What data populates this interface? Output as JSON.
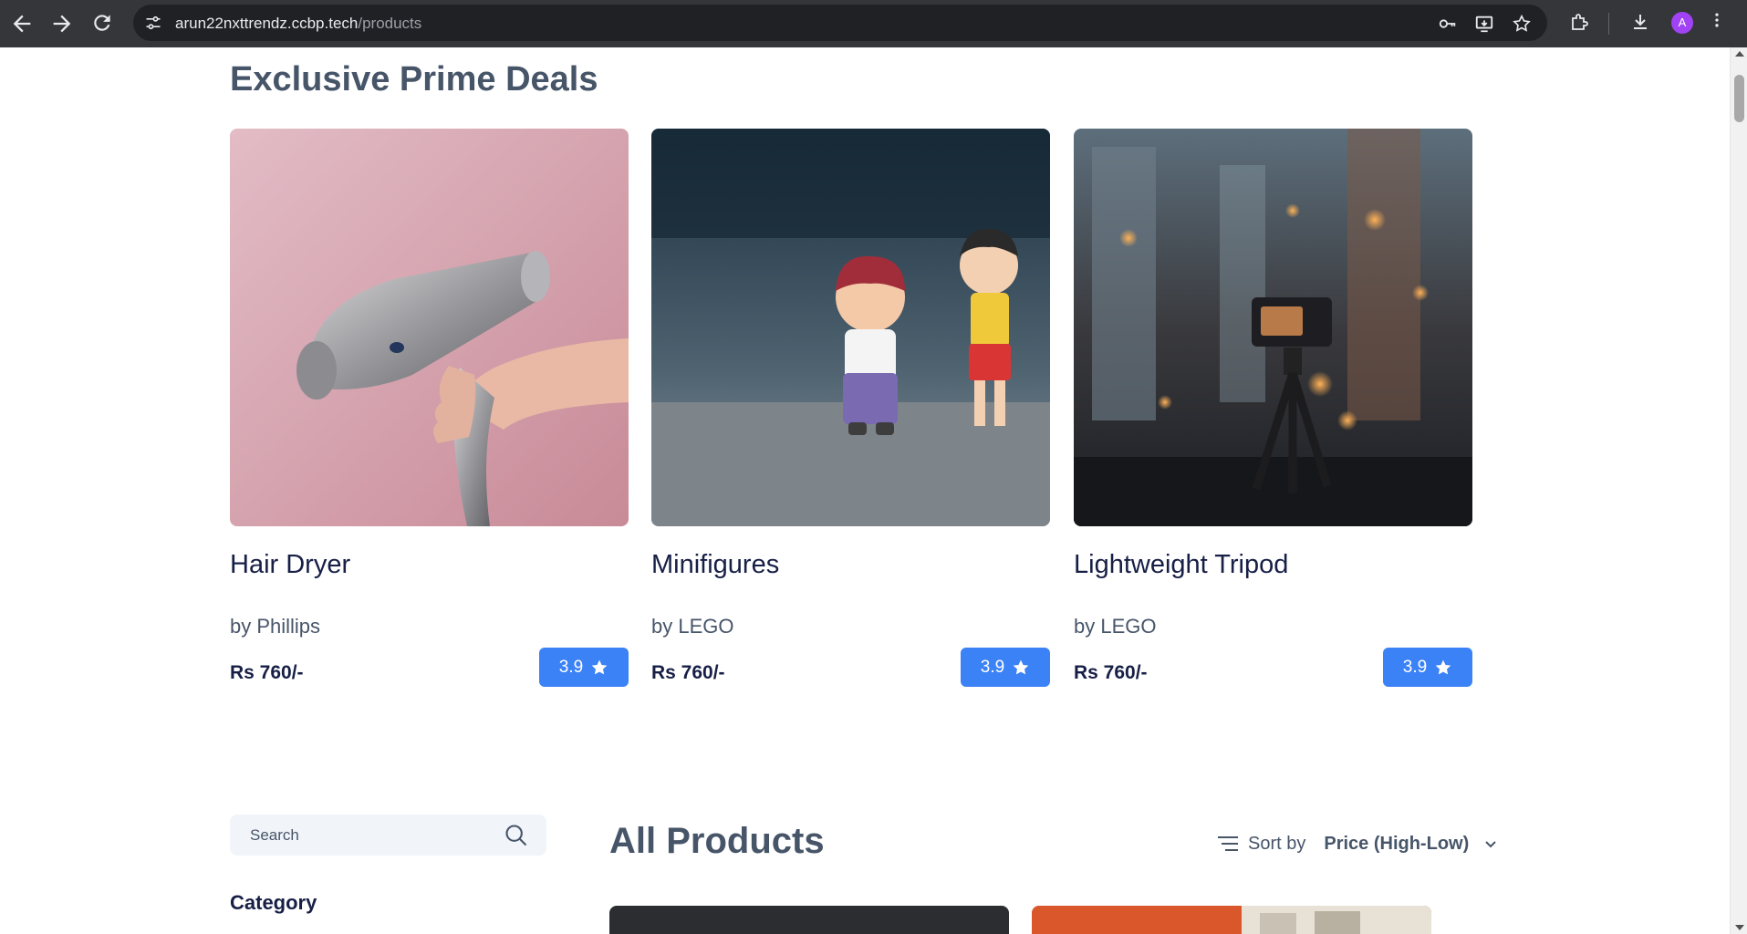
{
  "browser": {
    "url_host": "arun22nxttrendz.ccbp.tech",
    "url_path": "/products",
    "profile_initial": "A"
  },
  "prime": {
    "title": "Exclusive Prime Deals",
    "products": [
      {
        "title": "Hair Dryer",
        "brand": "by Phillips",
        "price": "Rs 760/-",
        "rating": "3.9"
      },
      {
        "title": "Minifigures",
        "brand": "by LEGO",
        "price": "Rs 760/-",
        "rating": "3.9"
      },
      {
        "title": "Lightweight Tripod",
        "brand": "by LEGO",
        "price": "Rs 760/-",
        "rating": "3.9"
      }
    ]
  },
  "filters": {
    "search_placeholder": "Search",
    "category_heading": "Category"
  },
  "all_products": {
    "title": "All Products",
    "sort_label": "Sort by",
    "sort_value": "Price (High-Low)"
  },
  "colors": {
    "rating_badge": "#3b82f6",
    "title_slate": "#475569",
    "product_navy": "#171f46"
  }
}
